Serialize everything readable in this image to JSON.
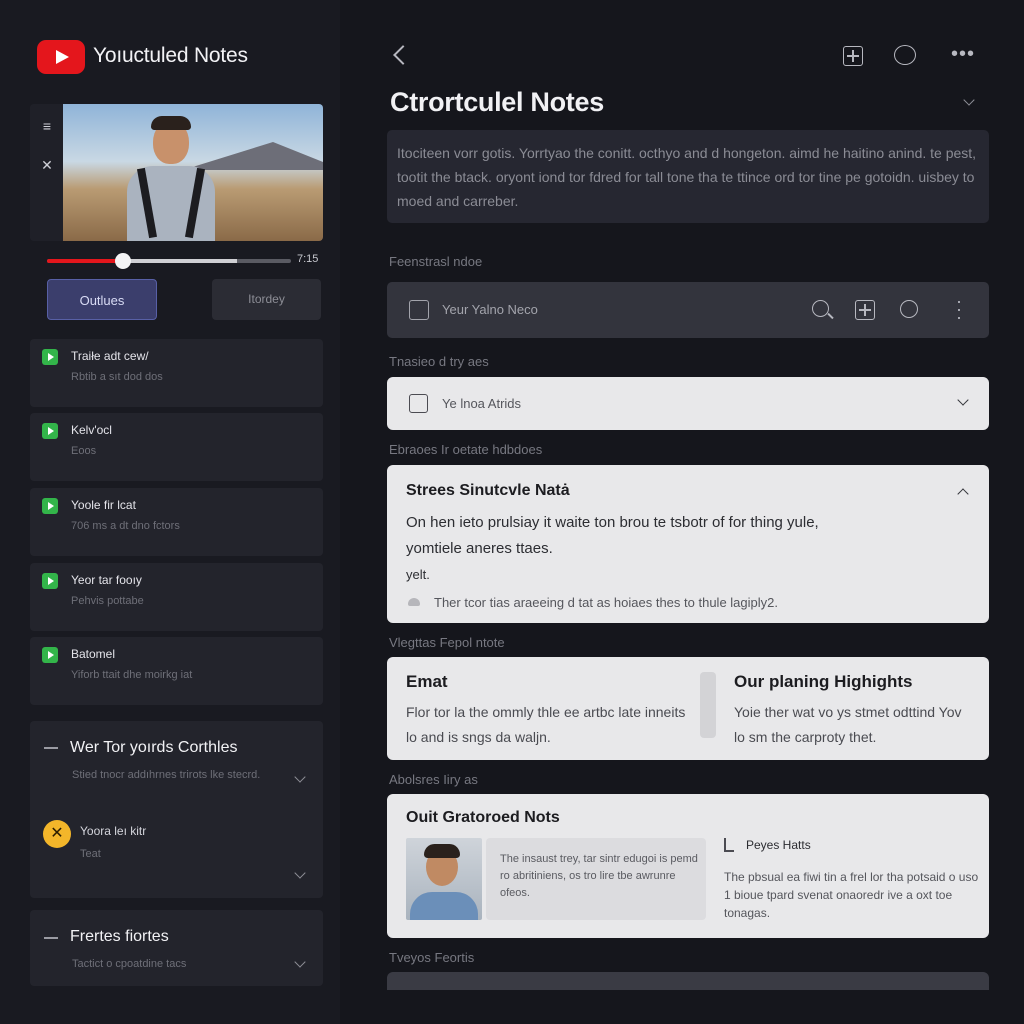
{
  "app": {
    "title": "Yoıuctuled Notes"
  },
  "sidebar": {
    "video": {
      "time": "7:15",
      "progress": 0.31,
      "buffered": 0.78
    },
    "buttons": {
      "primary": "Outlues",
      "secondary": "Itordey"
    },
    "chapters": [
      {
        "title": "Traiłe adt cew/",
        "sub": "Rbtib a sıt dod dos"
      },
      {
        "title": "Kelv'ocl",
        "sub": "Eoos"
      },
      {
        "title": "Yoole fir lcat",
        "sub": "706 ms a dt dno fctors"
      },
      {
        "title": "Yeor tar fooıy",
        "sub": "Pehvis pottabe"
      },
      {
        "title": "Batomel",
        "sub": "Yiforb ttait dhe moirkg iat"
      }
    ],
    "panel1": {
      "title": "Wer Tor yoırds Corthles",
      "sub": "Stied tnocr addıhrnes trirots lke stecrd.",
      "item": "Yoora leı kitr",
      "item_sub": "Teat"
    },
    "panel2": {
      "title": "Frertes fiortes",
      "sub": "Tactict o cpoatdine tacs"
    }
  },
  "main": {
    "title": "Ctrortculel Notes",
    "description": "Itociteen vorr gotis. Yorrtyao the conitt. octhyo and d hongeton. aimd he haitino anind. te pest, tootit the btack. oryont iond tor fdred for tall tone tha te ttince ord tor tine pe gotoidn. uisbey to moed and carreber.",
    "sections": {
      "featured": "Feenstrasl ndoe",
      "saved": "Tnasieo d try aes",
      "structure": "Ebraoes Ir oetate hdbdoes",
      "highlights": "Vlegttas Fepol ntote",
      "additional": "Abolsres Iiry as",
      "bottom": "Tveyos Feortis"
    },
    "search": {
      "placeholder": "Yeur Yalno Neco"
    },
    "saved_card": {
      "text": "Ye lnoa Atrids"
    },
    "structure_note": {
      "title": "Strees Sinutcvle Natȧ",
      "lines": [
        "On hen ieto prulsiay it waite ton brou te tsbotr of for thing yule,",
        "yomtiele aneres ttaes.",
        "yelt."
      ],
      "footnote": "Ther tcor tias araeeing d tat as hoiaes thes to thule lagiply2."
    },
    "highlights": {
      "left": {
        "title": "Emat",
        "text": "Flor tor la the ommly thle ee artbc late inneits lo and is sngs da waljn."
      },
      "right": {
        "title": "Our planing Highights",
        "text": "Yoie ther wat vo ys stmet odttind Yov lo sm the carproty thet."
      }
    },
    "featured_notes": {
      "title": "Ouit Gratoroed Nots",
      "quote": "The insaust trey, tar sintr edugoi is pemd ro abritiniens, os tro lire tbe awrunre ofeos.",
      "side_title": "Peyes Hatts",
      "side_text": "The pbsual ea fiwi tin a frel lor tha potsaid o uso 1 bioue tpard svenat onaoredr ive a oxt toe tonagas."
    }
  },
  "colors": {
    "accent": "#e4161c",
    "primary_button": "#3b3e6c",
    "check": "#33b54a",
    "badge": "#f3b62a"
  }
}
